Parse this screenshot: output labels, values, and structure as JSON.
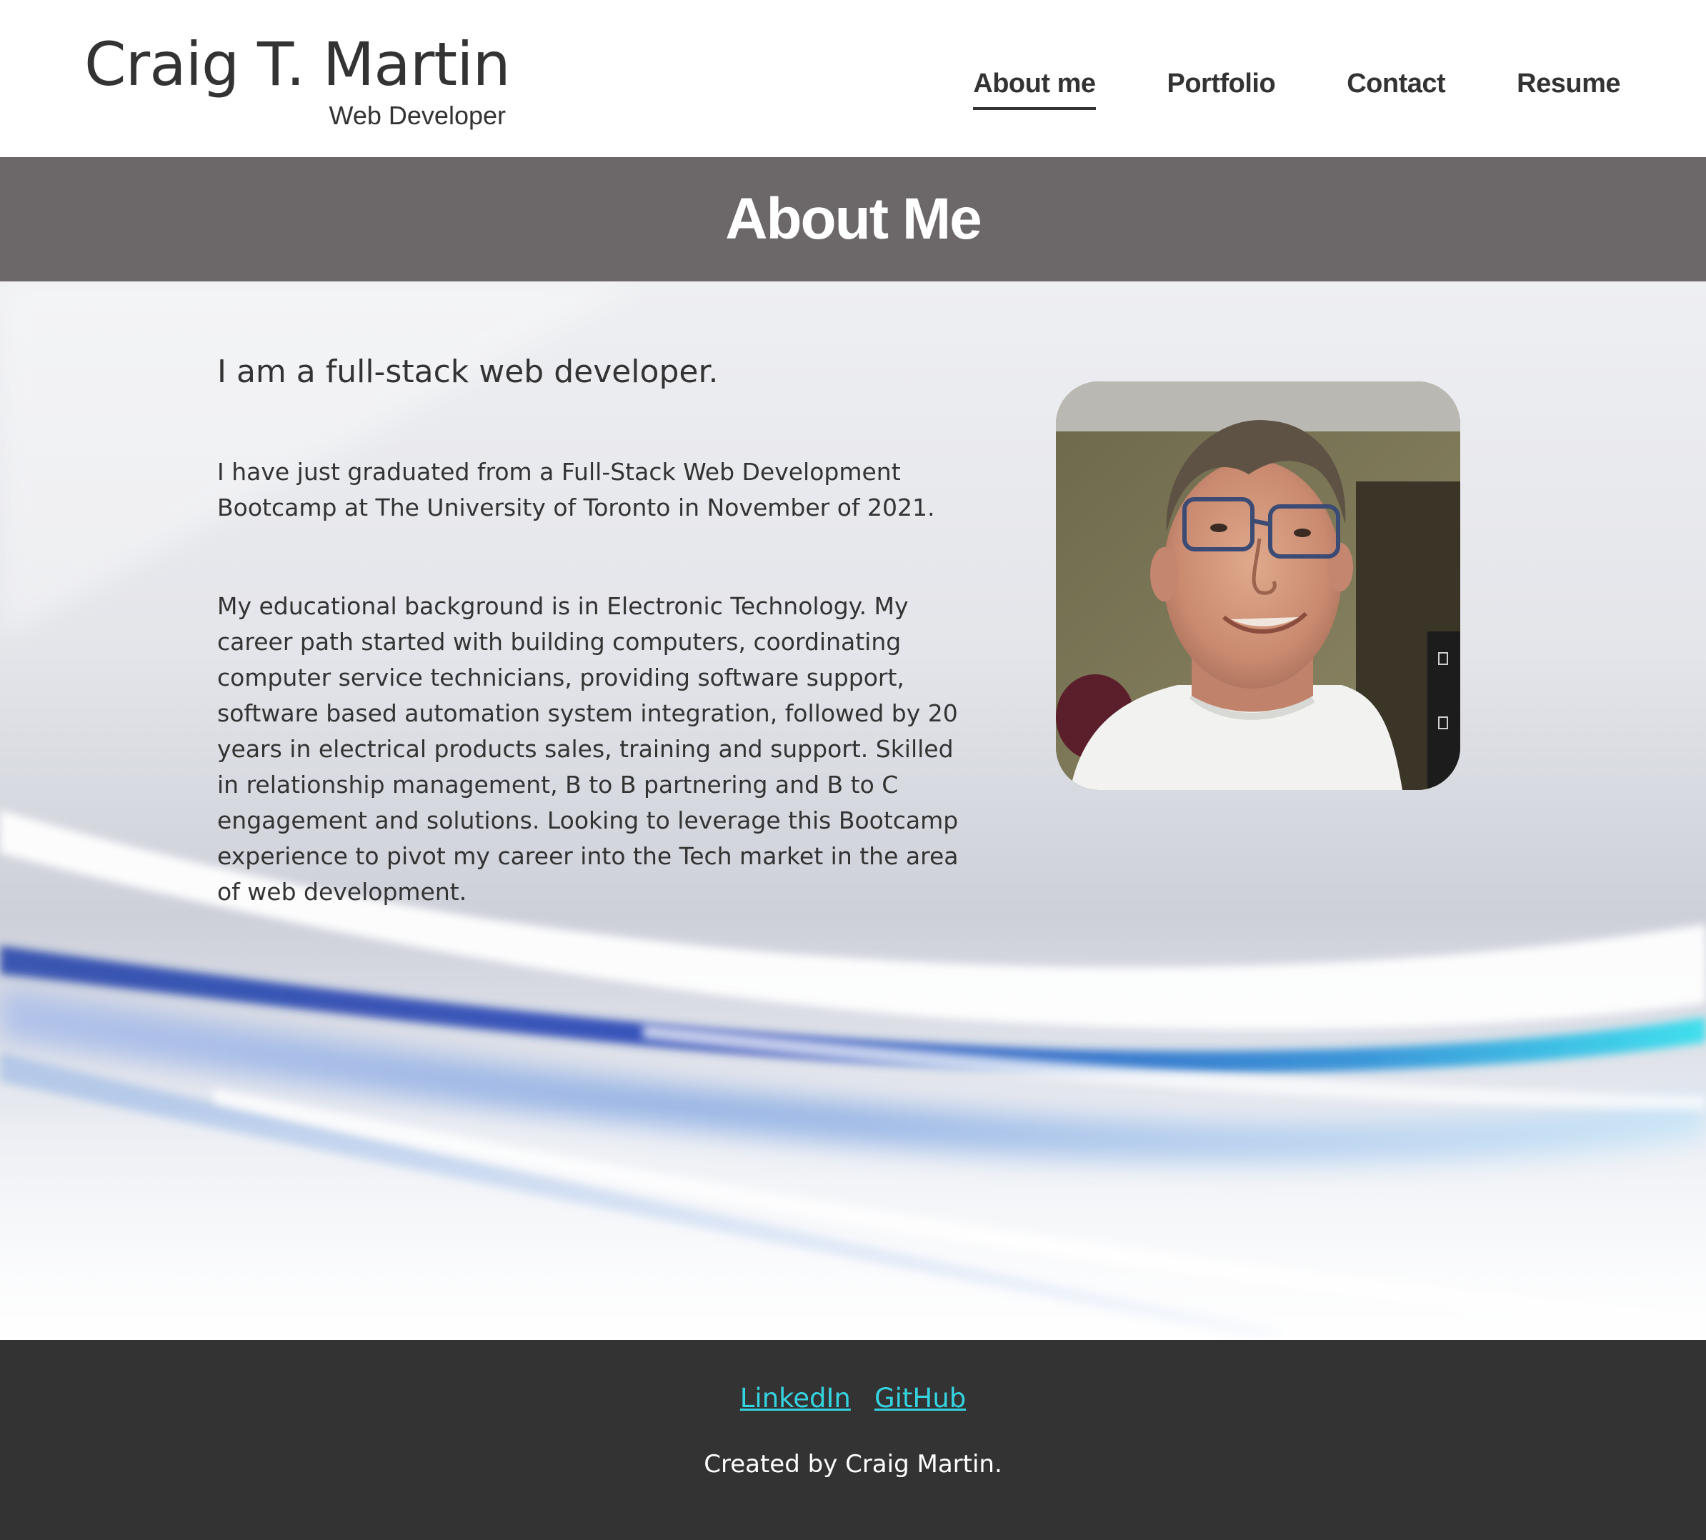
{
  "header": {
    "name": "Craig T. Martin",
    "role": "Web Developer"
  },
  "nav": {
    "items": [
      {
        "label": "About me",
        "active": true
      },
      {
        "label": "Portfolio",
        "active": false
      },
      {
        "label": "Contact",
        "active": false
      },
      {
        "label": "Resume",
        "active": false
      }
    ]
  },
  "page": {
    "title": "About Me"
  },
  "about": {
    "lead": "I am a full-stack web developer.",
    "paragraph_1": "I have just graduated from a Full-Stack Web Development Bootcamp at The University of Toronto in November of 2021.",
    "paragraph_2": "My educational background is in Electronic Technology. My career path started with building computers, coordinating computer service technicians, providing software support, software based automation system integration, followed by 20 years in electrical products sales, training and support. Skilled in relationship management, B to B partnering and B to C engagement and solutions. Looking to leverage this Bootcamp experience to pivot my career into the Tech market in the area of web development."
  },
  "footer": {
    "links": [
      {
        "label": "LinkedIn"
      },
      {
        "label": "GitHub"
      }
    ],
    "credit": "Created by Craig Martin."
  },
  "colors": {
    "title_band": "#6c6869",
    "footer_bg": "#333333",
    "link": "#35d3e0",
    "text": "#333333"
  }
}
